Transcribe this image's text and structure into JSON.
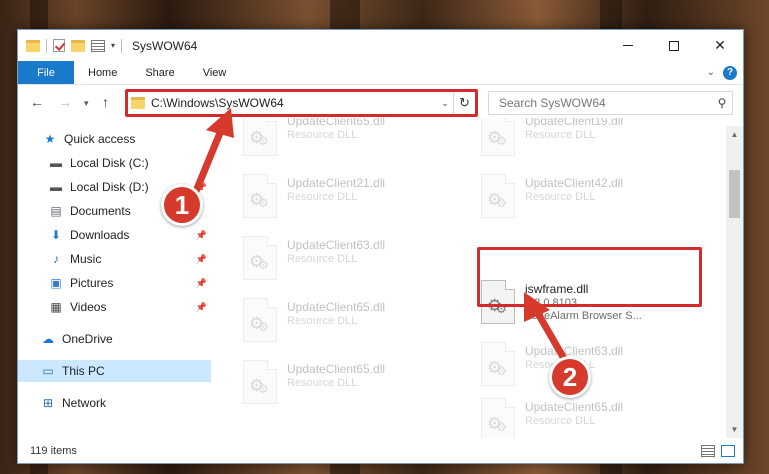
{
  "window": {
    "title": "SysWOW64",
    "controls": {
      "minimize": "",
      "maximize": "",
      "close": "✕"
    }
  },
  "ribbon": {
    "tabs": [
      "File",
      "Home",
      "Share",
      "View"
    ],
    "help": "?"
  },
  "address": {
    "path": "C:\\Windows\\SysWOW64",
    "refresh": "↻"
  },
  "search": {
    "placeholder": "Search SysWOW64"
  },
  "sidebar": {
    "items": [
      {
        "label": "Quick access",
        "icon": "star-icon"
      },
      {
        "label": "Local Disk (C:)",
        "icon": "drive-icon"
      },
      {
        "label": "Local Disk (D:)",
        "icon": "drive-icon"
      },
      {
        "label": "Documents",
        "icon": "documents-icon"
      },
      {
        "label": "Downloads",
        "icon": "download-icon"
      },
      {
        "label": "Music",
        "icon": "music-icon"
      },
      {
        "label": "Pictures",
        "icon": "pictures-icon"
      },
      {
        "label": "Videos",
        "icon": "videos-icon"
      },
      {
        "label": "OneDrive",
        "icon": "cloud-icon"
      },
      {
        "label": "This PC",
        "icon": "computer-icon"
      },
      {
        "label": "Network",
        "icon": "network-icon"
      }
    ]
  },
  "files": {
    "left": [
      {
        "name": "UpdateClient65.dll",
        "type": "Resource DLL"
      },
      {
        "name": "UpdateClient21.dll",
        "type": "Resource DLL"
      },
      {
        "name": "UpdateClient63.dll",
        "type": "Resource DLL"
      },
      {
        "name": "UpdateClient65.dll",
        "type": "Resource DLL"
      },
      {
        "name": "UpdateClient65.dll",
        "type": "Resource DLL"
      }
    ],
    "right": [
      {
        "name": "UpdateClient19.dll",
        "type": "Resource DLL"
      },
      {
        "name": "UpdateClient42.dll",
        "type": "Resource DLL"
      },
      {
        "name": "iswframe.dll",
        "version": "1.2.0.8103",
        "description": "ZoneAlarm Browser S..."
      },
      {
        "name": "UpdateClient63.dll",
        "type": "Resource DLL"
      },
      {
        "name": "UpdateClient65.dll",
        "type": "Resource DLL"
      }
    ]
  },
  "status": {
    "item_count": "119 items"
  },
  "annotations": {
    "step1": "1",
    "step2": "2",
    "color": "#d63a2c"
  }
}
